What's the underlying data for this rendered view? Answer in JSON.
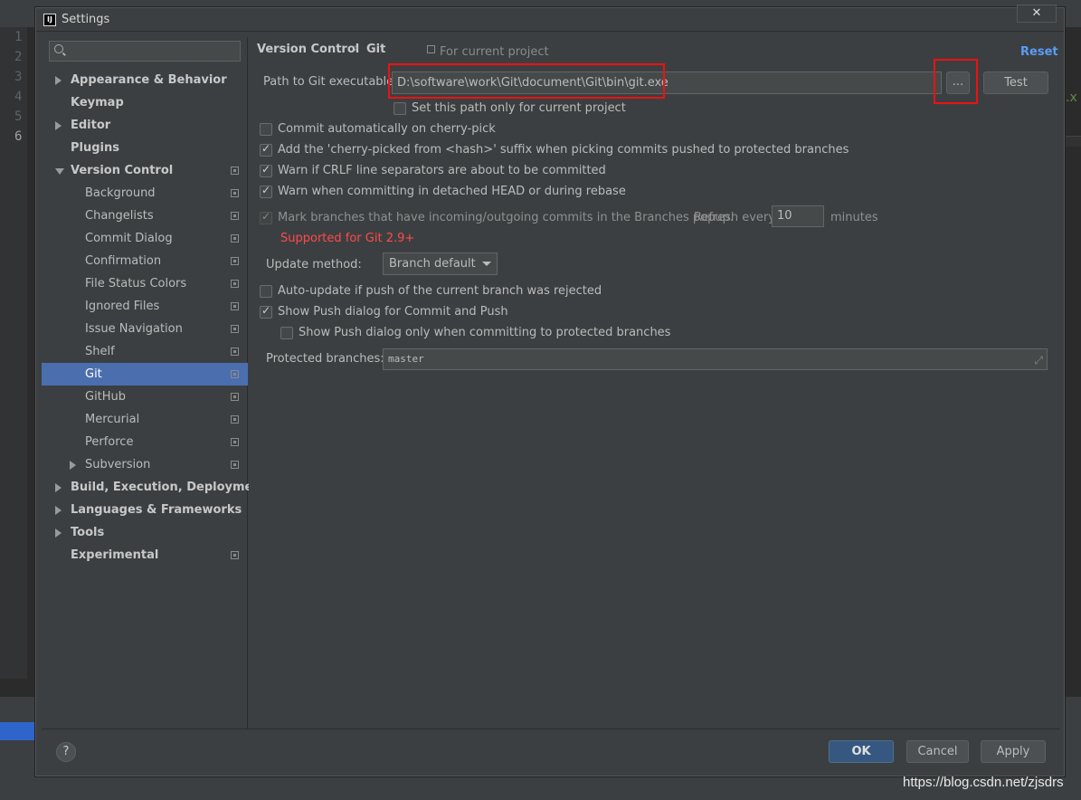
{
  "background_ide": {
    "line_numbers": [
      "1",
      "2",
      "3",
      "4",
      "5",
      "6"
    ],
    "right_fragment": ".x"
  },
  "dialog": {
    "title": "Settings",
    "app_icon": "IJ",
    "close_glyph": "✕"
  },
  "sidebar": {
    "search_placeholder": "",
    "items": [
      {
        "label": "Appearance & Behavior",
        "level": 0,
        "arrow": "right",
        "proj": false
      },
      {
        "label": "Keymap",
        "level": 0,
        "arrow": "none",
        "proj": false
      },
      {
        "label": "Editor",
        "level": 0,
        "arrow": "right",
        "proj": false
      },
      {
        "label": "Plugins",
        "level": 0,
        "arrow": "none",
        "proj": false
      },
      {
        "label": "Version Control",
        "level": 0,
        "arrow": "down",
        "proj": true
      },
      {
        "label": "Background",
        "level": 1,
        "arrow": "none",
        "proj": true
      },
      {
        "label": "Changelists",
        "level": 1,
        "arrow": "none",
        "proj": true
      },
      {
        "label": "Commit Dialog",
        "level": 1,
        "arrow": "none",
        "proj": true
      },
      {
        "label": "Confirmation",
        "level": 1,
        "arrow": "none",
        "proj": true
      },
      {
        "label": "File Status Colors",
        "level": 1,
        "arrow": "none",
        "proj": true
      },
      {
        "label": "Ignored Files",
        "level": 1,
        "arrow": "none",
        "proj": true
      },
      {
        "label": "Issue Navigation",
        "level": 1,
        "arrow": "none",
        "proj": true
      },
      {
        "label": "Shelf",
        "level": 1,
        "arrow": "none",
        "proj": true
      },
      {
        "label": "Git",
        "level": 1,
        "arrow": "none",
        "proj": true,
        "selected": true
      },
      {
        "label": "GitHub",
        "level": 1,
        "arrow": "none",
        "proj": true
      },
      {
        "label": "Mercurial",
        "level": 1,
        "arrow": "none",
        "proj": true
      },
      {
        "label": "Perforce",
        "level": 1,
        "arrow": "none",
        "proj": true
      },
      {
        "label": "Subversion",
        "level": 1,
        "arrow": "right",
        "proj": true
      },
      {
        "label": "Build, Execution, Deployment",
        "level": 0,
        "arrow": "right",
        "proj": false
      },
      {
        "label": "Languages & Frameworks",
        "level": 0,
        "arrow": "right",
        "proj": false
      },
      {
        "label": "Tools",
        "level": 0,
        "arrow": "right",
        "proj": false
      },
      {
        "label": "Experimental",
        "level": 0,
        "arrow": "none",
        "proj": true
      }
    ]
  },
  "content": {
    "breadcrumb_parent": "Version Control",
    "breadcrumb_sep": "›",
    "breadcrumb_current": "Git",
    "for_current_project": "For current project",
    "reset": "Reset",
    "path_label": "Path to Git executable:",
    "path_value": "D:\\software\\work\\Git\\document\\Git\\bin\\git.exe",
    "browse_label": "...",
    "test_label": "Test",
    "set_path_only": "Set this path only for current project",
    "commit_auto_cherry": "Commit automatically on cherry-pick",
    "add_cherry_suffix": "Add the 'cherry-picked from <hash>' suffix when picking commits pushed to protected branches",
    "warn_crlf": "Warn if CRLF line separators are about to be committed",
    "warn_detached": "Warn when committing in detached HEAD or during rebase",
    "mark_branches": "Mark branches that have incoming/outgoing commits in the Branches popup.",
    "refresh_every": "Refresh every",
    "refresh_value": "10",
    "minutes": "minutes",
    "supported_git": "Supported for Git 2.9+",
    "update_method_label": "Update method:",
    "update_method_value": "Branch default",
    "auto_update": "Auto-update if push of the current branch was rejected",
    "show_push_dialog": "Show Push dialog for Commit and Push",
    "show_push_protected": "Show Push dialog only when committing to protected branches",
    "protected_label": "Protected branches:",
    "protected_value": "master"
  },
  "footer": {
    "help": "?",
    "ok": "OK",
    "cancel": "Cancel",
    "apply": "Apply"
  },
  "watermark": "https://blog.csdn.net/zjsdrs",
  "colors": {
    "selection": "#4b6eaf",
    "highlight_box": "#ee1111",
    "link": "#589df6",
    "warning_text": "#ff4a4a"
  }
}
